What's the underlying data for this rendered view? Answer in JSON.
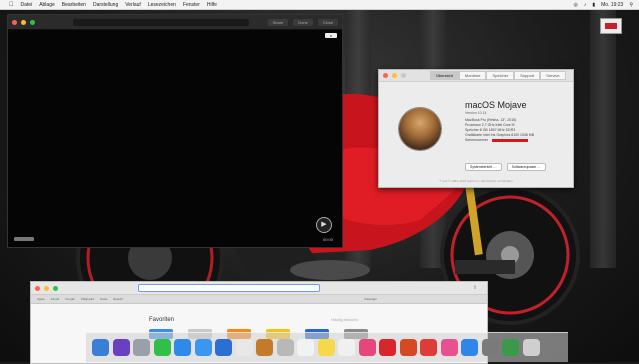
{
  "menubar": {
    "apple": "",
    "items": [
      "Datei",
      "Ablage",
      "Bearbeiten",
      "Darstellung",
      "Verlauf",
      "Lesezeichen",
      "Fenster",
      "Hilfe"
    ],
    "status": [
      "Mo. 19:23"
    ]
  },
  "player": {
    "title": "",
    "buttons": [
      "Share",
      "Done",
      "Close"
    ],
    "close_label": "x",
    "play_icon": "play-circle-icon"
  },
  "about_mac": {
    "tabs": [
      "Übersicht",
      "Monitore",
      "Speicher",
      "Support",
      "Service"
    ],
    "os_name": "macOS Mojave",
    "os_version": "Version 10.14",
    "specs": [
      "MacBook Pro (Retina, 13\", 2015)",
      "Prozessor   2,7 GHz Intel Core i5",
      "Speicher   8 GB 1867 MHz DDR3",
      "Grafikkarte   Intel Iris Graphics 6100 1536 MB",
      "Seriennummer"
    ],
    "buttons": [
      "Systembericht …",
      "Softwareupdate …"
    ],
    "footer": "™ und © 1983–2018 Apple Inc. Alle Rechte vorbehalten."
  },
  "widget": {
    "label": ""
  },
  "safari": {
    "bookmarks": [
      "Apple",
      "iCloud",
      "Google",
      "Wikipedia",
      "News",
      "Beliebt"
    ],
    "tab_label": "Favoriten",
    "favorites_title": "Favoriten",
    "favorites_sub": "Häufig besucht",
    "tile_colors": [
      "#3a8ee6",
      "#c9c9c9",
      "#f28a1b",
      "#f3c11a",
      "#2b66c9",
      "#8a8a8a"
    ]
  },
  "dock": {
    "icons": [
      {
        "name": "finder-icon",
        "color": "#3a7fd6"
      },
      {
        "name": "siri-icon",
        "color": "#6a3fc2"
      },
      {
        "name": "launchpad-icon",
        "color": "#9aa0a8"
      },
      {
        "name": "messages-icon",
        "color": "#30c04a"
      },
      {
        "name": "safari-icon",
        "color": "#2e8ae8"
      },
      {
        "name": "mail-icon",
        "color": "#3a96f0"
      },
      {
        "name": "xcode-icon",
        "color": "#2a6fd1"
      },
      {
        "name": "photos-icon",
        "color": "#e8e8e8"
      },
      {
        "name": "preview-icon",
        "color": "#c27b2a"
      },
      {
        "name": "notes-icon",
        "color": "#b8b8b8"
      },
      {
        "name": "calendar-icon",
        "color": "#f2f2f2"
      },
      {
        "name": "stickies-icon",
        "color": "#f5d94a"
      },
      {
        "name": "itunes-icon",
        "color": "#f0f0f0"
      },
      {
        "name": "pink-app-icon",
        "color": "#e7467a"
      },
      {
        "name": "red-app-icon",
        "color": "#d9262c"
      },
      {
        "name": "powerpoint-icon",
        "color": "#d64a23"
      },
      {
        "name": "photo-booth-icon",
        "color": "#e03b3b"
      },
      {
        "name": "music-icon",
        "color": "#e8508f"
      },
      {
        "name": "app-store-icon",
        "color": "#2f86e8"
      },
      {
        "name": "system-preferences-icon",
        "color": "#7a7a7a"
      },
      {
        "name": "security-icon",
        "color": "#3a9a4a"
      },
      {
        "name": "trash-icon",
        "color": "#cfcfcf"
      }
    ]
  }
}
